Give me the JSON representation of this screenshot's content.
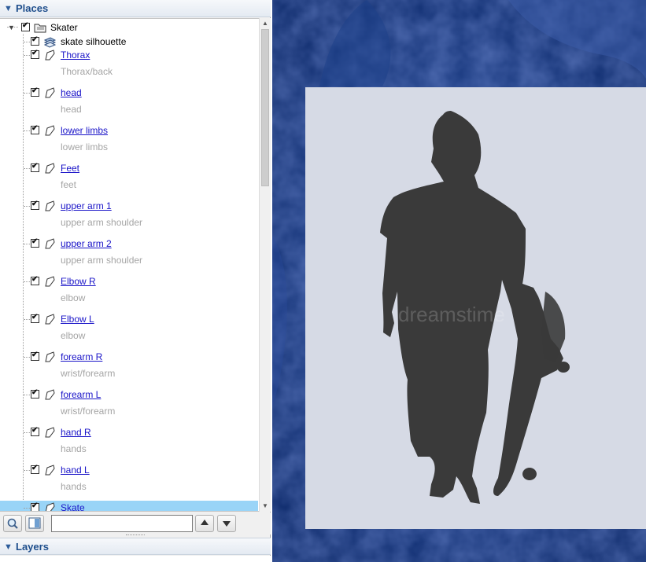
{
  "places": {
    "header": "Places",
    "root": {
      "label": "Skater"
    },
    "items": [
      {
        "label": "skate silhouette",
        "link": false,
        "description": ""
      },
      {
        "label": "Thorax",
        "link": true,
        "description": "Thorax/back"
      },
      {
        "label": "head",
        "link": true,
        "description": "head"
      },
      {
        "label": "lower limbs",
        "link": true,
        "description": "lower limbs"
      },
      {
        "label": "Feet",
        "link": true,
        "description": "feet"
      },
      {
        "label": "upper arm 1",
        "link": true,
        "description": "upper arm shoulder"
      },
      {
        "label": "upper arm 2",
        "link": true,
        "description": "upper arm shoulder"
      },
      {
        "label": "Elbow R",
        "link": true,
        "description": "elbow"
      },
      {
        "label": "Elbow L",
        "link": true,
        "description": "elbow"
      },
      {
        "label": "forearm R",
        "link": true,
        "description": "wrist/forearm"
      },
      {
        "label": "forearm L",
        "link": true,
        "description": "wrist/forearm"
      },
      {
        "label": "hand R",
        "link": true,
        "description": "hands"
      },
      {
        "label": "hand L",
        "link": true,
        "description": "hands"
      },
      {
        "label": "Skate",
        "link": true,
        "description": ""
      }
    ]
  },
  "toolbar": {
    "search_value": ""
  },
  "layers": {
    "header": "Layers"
  },
  "overlay": {
    "watermark": "dreamstime"
  },
  "colors": {
    "accent": "#1e4e8c",
    "selection": "#99d4f7",
    "link": "#1a14c8",
    "globe": "#0d2a6b",
    "overlay_bg": "#d6dae5",
    "silhouette": "#3a3a3a"
  },
  "icons": {
    "expander": "triangle-down-icon",
    "folder": "folder-icon",
    "image_overlay": "image-overlay-icon",
    "polygon": "polygon-icon",
    "search": "magnifier-icon",
    "split_view": "split-view-icon",
    "move_up": "arrow-up-icon",
    "move_down": "arrow-down-icon"
  }
}
